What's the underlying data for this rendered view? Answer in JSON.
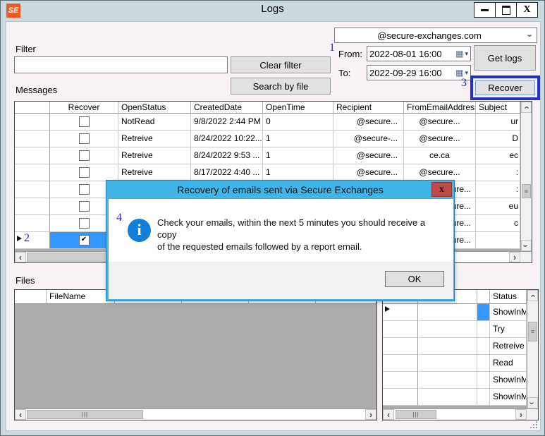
{
  "window": {
    "title": "Logs",
    "icon_text": "SE"
  },
  "toolbar": {
    "domain_combo_value": "@secure-exchanges.com",
    "filter_label": "Filter",
    "filter_value": "",
    "clear_filter_label": "Clear filter",
    "search_by_file_label": "Search by file",
    "from_label": "From:",
    "from_value": "2022-08-01 16:00",
    "to_label": "To:",
    "to_value": "2022-09-29 16:00",
    "get_logs_label": "Get logs",
    "recover_label": "Recover"
  },
  "annotations": {
    "step1": "1",
    "step2": "2",
    "step3": "3",
    "step4": "4"
  },
  "messages": {
    "section_label": "Messages",
    "columns": {
      "recover": "Recover",
      "open_status": "OpenStatus",
      "created_date": "CreatedDate",
      "open_time": "OpenTime",
      "recipient": "Recipient",
      "from_email": "FromEmailAddress",
      "subject": "Subject"
    },
    "rows": [
      {
        "check": "",
        "open_status": "NotRead",
        "created_date": "9/8/2022 2:44 PM",
        "open_time": "0",
        "recipient": "@secure...",
        "from": "@secure...",
        "subject": "ur"
      },
      {
        "check": "",
        "open_status": "Retreive",
        "created_date": "8/24/2022 10:22...",
        "open_time": "1",
        "recipient": "@secure-...",
        "from": "@secure...",
        "subject": "D"
      },
      {
        "check": "",
        "open_status": "Retreive",
        "created_date": "8/24/2022 9:53 ...",
        "open_time": "1",
        "recipient": "@secure...",
        "from": "ce.ca",
        "subject": "ec"
      },
      {
        "check": "",
        "open_status": "Retreive",
        "created_date": "8/17/2022 4:40 ...",
        "open_time": "1",
        "recipient": "@secure...",
        "from": "@secure...",
        "subject": ":"
      },
      {
        "check": "",
        "open_status": "",
        "created_date": "",
        "open_time": "",
        "recipient": "",
        "from": "@secure...",
        "subject": ":"
      },
      {
        "check": "",
        "open_status": "",
        "created_date": "",
        "open_time": "",
        "recipient": "",
        "from": "@secure...",
        "subject": "eu"
      },
      {
        "check": "",
        "open_status": "",
        "created_date": "",
        "open_time": "",
        "recipient": "",
        "from": "@secure...",
        "subject": "c"
      },
      {
        "check": "✔",
        "open_status": "",
        "created_date": "",
        "open_time": "",
        "recipient": "",
        "from": "@secure...",
        "subject": ""
      }
    ]
  },
  "files": {
    "section_label": "Files",
    "columns": {
      "filename": "FileName"
    }
  },
  "status_grid": {
    "columns": {
      "status": "Status"
    },
    "rows": [
      "ShowInM",
      "Try",
      "Retreive",
      "Read",
      "ShowInM",
      "ShowInM"
    ]
  },
  "dialog": {
    "title": "Recovery of emails sent via Secure Exchanges",
    "info_glyph": "i",
    "message_line1": "Check your emails, within the next 5 minutes you should receive a copy",
    "message_line2": "of the requested emails followed by a report email.",
    "ok_label": "OK",
    "close_glyph": "x"
  },
  "icons": {
    "chevron": "›",
    "chevron_left": "‹",
    "grip_vertical": "≡",
    "grip_horizontal": "|||",
    "calendar": "▦",
    "caret_down": "▾",
    "close_glyph": "X"
  },
  "colors": {
    "dialog_titlebar": "#41b4e8",
    "selection_blue": "#3399ff",
    "annotation_blue": "#2828c8",
    "close_button_red": "#bf4a4a",
    "app_icon_orange": "#f05a22",
    "window_chrome": "#ccdadf",
    "client_background": "#f8f2f7"
  }
}
